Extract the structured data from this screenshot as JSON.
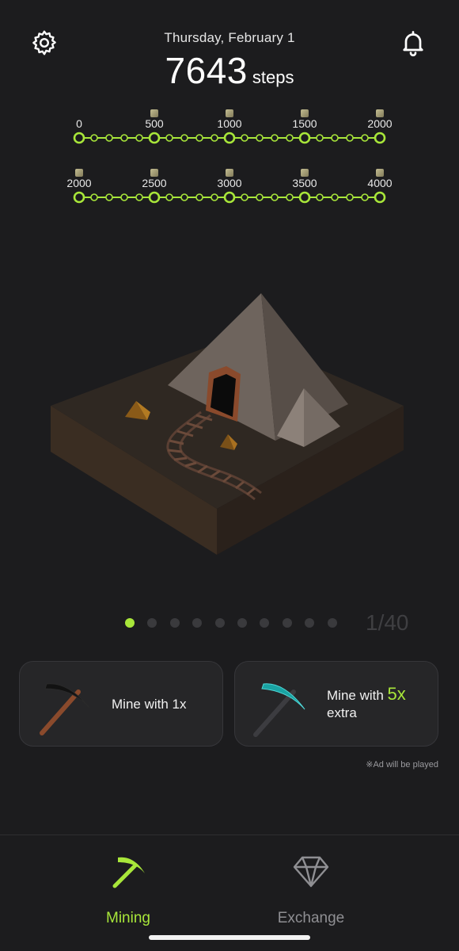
{
  "header": {
    "date": "Thursday, February 1",
    "steps": "7643",
    "steps_unit": "steps",
    "settings_icon": "gear-icon",
    "notifications_icon": "bell-icon"
  },
  "tracks": [
    {
      "labels": [
        "0",
        "500",
        "1000",
        "1500",
        "2000"
      ]
    },
    {
      "labels": [
        "2000",
        "2500",
        "3000",
        "3500",
        "4000"
      ]
    }
  ],
  "colors": {
    "accent": "#a8e63a",
    "background": "#1c1c1e",
    "card": "#262628",
    "inactive": "#8f8f93"
  },
  "pager": {
    "total_dots": 10,
    "active_index": 0,
    "count_text": "1/40"
  },
  "mine": {
    "basic_label": "Mine with 1x",
    "extra_prefix": "Mine with",
    "extra_multiplier": "5x",
    "extra_suffix": "extra",
    "ad_note": "※Ad will be played"
  },
  "nav": {
    "mining_label": "Mining",
    "exchange_label": "Exchange",
    "active": "Mining"
  }
}
